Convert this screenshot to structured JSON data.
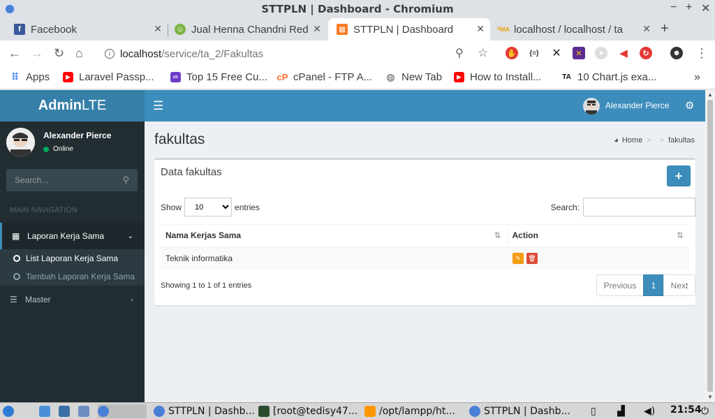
{
  "window": {
    "title": "STTPLN | Dashboard - Chromium",
    "controls": [
      "−",
      "+",
      "✕"
    ]
  },
  "tabs": [
    {
      "label": "Facebook",
      "icon": "facebook-icon",
      "color": "#3b5998"
    },
    {
      "label": "Jual Henna Chandni Red",
      "icon": "shop-icon",
      "color": "#4caf50"
    },
    {
      "label": "STTPLN | Dashboard",
      "icon": "xampp-icon",
      "color": "#fb7a24",
      "active": true
    },
    {
      "label": "localhost / localhost / ta",
      "icon": "phpmyadmin-icon",
      "color": "#f0a30a"
    }
  ],
  "toolbar": {
    "url_host": "localhost",
    "url_path": "/service/ta_2/Fakultas"
  },
  "bookmarks": [
    {
      "label": "Apps",
      "icon": "apps-grid-icon"
    },
    {
      "label": "Laravel Passp...",
      "icon": "youtube-icon",
      "color": "#ff0000"
    },
    {
      "label": "Top 15 Free Cu...",
      "icon": "colorlib-icon",
      "color": "#6c3cc9"
    },
    {
      "label": "cPanel - FTP A...",
      "icon": "cpanel-icon",
      "color": "#ff6c2c"
    },
    {
      "label": "New Tab",
      "icon": "globe-icon",
      "color": "#555555"
    },
    {
      "label": "How to Install...",
      "icon": "youtube-icon",
      "color": "#ff0000"
    },
    {
      "label": "10 Chart.js exa...",
      "icon": "tutorial-icon",
      "color": "#111111"
    }
  ],
  "app": {
    "logo_bold": "Admin",
    "logo_light": "LTE",
    "user_name": "Alexander Pierce",
    "status": "Online",
    "search_placeholder": "Search...",
    "nav_header": "MAIN NAVIGATION",
    "menu": [
      {
        "label": "Laporan Kerja Sama",
        "icon": "calculator-icon",
        "active": true,
        "children": [
          {
            "label": "List Laporan Kerja Sama",
            "current": true
          },
          {
            "label": "Tambah Laporan Kerja Sama",
            "current": false
          }
        ]
      },
      {
        "label": "Master",
        "icon": "list-icon",
        "active": false
      }
    ]
  },
  "content": {
    "title": "fakultas",
    "breadcrumb": {
      "home": "Home",
      "current": "fakultas"
    },
    "box_title": "Data fakultas",
    "show_label": "Show",
    "entries_label": "entries",
    "page_length": "10",
    "search_label": "Search:",
    "columns": [
      "Nama Kerjas Sama",
      "Action"
    ],
    "rows": [
      {
        "name": "Teknik informatika"
      }
    ],
    "info": "Showing 1 to 1 of 1 entries",
    "pagination": {
      "previous": "Previous",
      "current": "1",
      "next": "Next"
    }
  },
  "taskbar": {
    "tasks": [
      "STTPLN | Dashb...",
      "[root@tedisy47...",
      "/opt/lampp/ht...",
      "STTPLN | Dashb..."
    ],
    "clock": "21:54"
  },
  "colors": {
    "primary": "#3c8dbc",
    "logo_bg": "#367fa9",
    "sidebar": "#222d32",
    "edit": "#f39c12",
    "delete": "#dd4b39"
  }
}
